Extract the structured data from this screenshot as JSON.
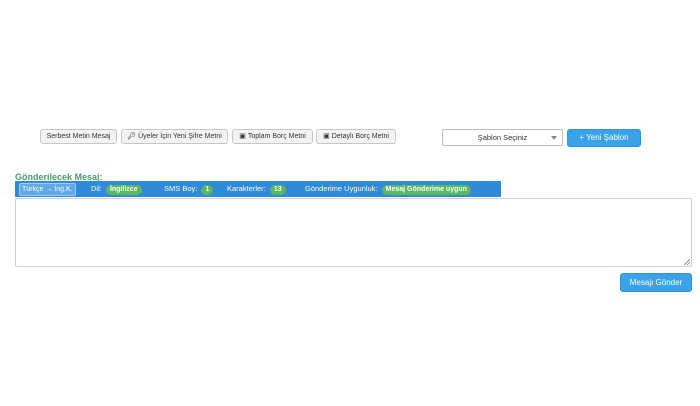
{
  "toolbar": {
    "free_text": "Serbest Metin Mesaj",
    "new_password": "Üyeler İçin Yeni Şifre Metni",
    "total_debt": "Toplam Borç Metni",
    "detailed_debt": "Detaylı Borç Metni",
    "icons": {
      "new_password": "key-icon",
      "total_debt": "money-icon",
      "detailed_debt": "money-icon"
    }
  },
  "template": {
    "select_value": "Şablon Seçiniz",
    "new_template_label": "+ Yeni Şablon"
  },
  "message": {
    "heading": "Gönderilecek Mesaj:",
    "transliterate_label": "Türkçe → İng.K.",
    "language_label": "Dil:",
    "language_value": "İngilizce",
    "sms_size_label": "SMS Boy:",
    "sms_size_value": "1",
    "characters_label": "Karakterler:",
    "characters_value": "13",
    "suitability_label": "Gönderime Uygunluk:",
    "suitability_value": "Mesaj Gönderime uygun",
    "text": ""
  },
  "send_label": "Mesajı Gönder",
  "colors": {
    "primary": "#3aa3e8",
    "info_bar": "#2f8bd9",
    "badge": "#5cb85c",
    "heading": "#4a9a73"
  }
}
